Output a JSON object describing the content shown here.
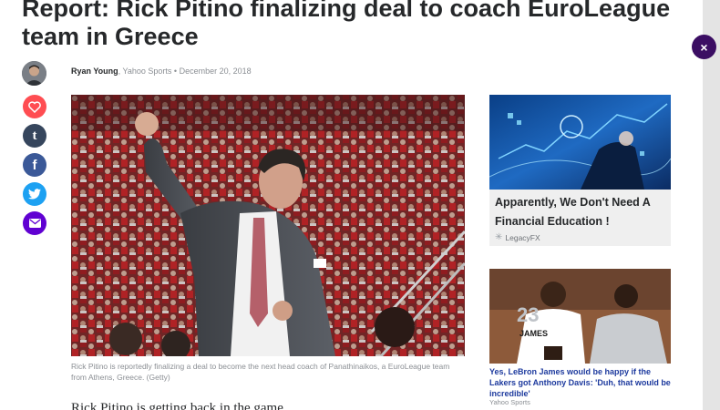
{
  "article": {
    "headline": "Report: Rick Pitino finalizing deal to coach EuroLeague team in Greece",
    "author": "Ryan Young",
    "publisher": "Yahoo Sports",
    "separator": "•",
    "date": "December 20, 2018",
    "image_caption": "Rick Pitino is reportedly finalizing a deal to become the next head coach of Panathinaikos, a EuroLeague team from Athens, Greece. (Getty)",
    "lead": "Rick Pitino is getting back in the game."
  },
  "share": {
    "heart_color": "#ff4d52",
    "tumblr_color": "#36465d",
    "facebook_color": "#3b5998",
    "twitter_color": "#1da1f2",
    "mail_color": "#6001d2"
  },
  "sidebar": {
    "ad": {
      "title": "Apparently, We Don't Need A Financial Education !",
      "source": "LegacyFX"
    },
    "story": {
      "title": "Yes, LeBron James would be happy if the Lakers got Anthony Davis: 'Duh, that would be incredible'",
      "source": "Yahoo Sports",
      "jersey_name": "JAMES",
      "jersey_number": "23"
    }
  },
  "close_label": "×"
}
